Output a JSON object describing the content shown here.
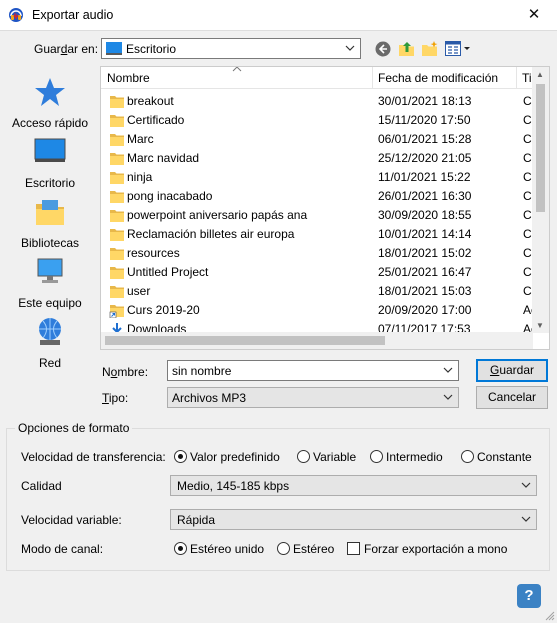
{
  "window": {
    "title": "Exportar audio",
    "close_glyph": "✕"
  },
  "save_in": {
    "label_pre": "Guar",
    "label_key": "d",
    "label_post": "ar en:",
    "value": "Escritorio"
  },
  "toolbar": {
    "icons": [
      "back-icon",
      "up-folder-icon",
      "new-folder-icon",
      "view-menu-icon"
    ]
  },
  "places": [
    {
      "label": "Acceso rápido",
      "icon": "quick-access-star-icon"
    },
    {
      "label": "Escritorio",
      "icon": "desktop-icon"
    },
    {
      "label": "Bibliotecas",
      "icon": "libraries-icon"
    },
    {
      "label": "Este equipo",
      "icon": "this-pc-icon"
    },
    {
      "label": "Red",
      "icon": "network-icon"
    }
  ],
  "columns": {
    "name": "Nombre",
    "date": "Fecha de modificación",
    "type": "Tip"
  },
  "files": [
    {
      "name": "breakout",
      "date": "30/01/2021 18:13",
      "type": "Ca",
      "icon": "folder-icon"
    },
    {
      "name": "Certificado",
      "date": "15/11/2020 17:50",
      "type": "Ca",
      "icon": "folder-icon"
    },
    {
      "name": "Marc",
      "date": "06/01/2021 15:28",
      "type": "Ca",
      "icon": "folder-icon"
    },
    {
      "name": "Marc navidad",
      "date": "25/12/2020 21:05",
      "type": "Ca",
      "icon": "folder-icon"
    },
    {
      "name": "ninja",
      "date": "11/01/2021 15:22",
      "type": "Ca",
      "icon": "folder-icon"
    },
    {
      "name": "pong inacabado",
      "date": "26/01/2021 16:30",
      "type": "Ca",
      "icon": "folder-icon"
    },
    {
      "name": "powerpoint aniversario papás ana",
      "date": "30/09/2020 18:55",
      "type": "Ca",
      "icon": "folder-icon"
    },
    {
      "name": "Reclamación billetes air europa",
      "date": "10/01/2021 14:14",
      "type": "Ca",
      "icon": "folder-icon"
    },
    {
      "name": "resources",
      "date": "18/01/2021 15:02",
      "type": "Ca",
      "icon": "folder-icon"
    },
    {
      "name": "Untitled Project",
      "date": "25/01/2021 16:47",
      "type": "Ca",
      "icon": "folder-icon"
    },
    {
      "name": "user",
      "date": "18/01/2021 15:03",
      "type": "Ca",
      "icon": "folder-icon"
    },
    {
      "name": "Curs 2019-20",
      "date": "20/09/2020 17:00",
      "type": "Ac",
      "icon": "folder-shortcut-icon"
    },
    {
      "name": "Downloads",
      "date": "07/11/2017 17:53",
      "type": "Ac",
      "icon": "downloads-shortcut-icon"
    }
  ],
  "filename": {
    "label_pre": "N",
    "label_key": "o",
    "label_post": "mbre:",
    "value": "sin nombre"
  },
  "filetype": {
    "label_pre": "",
    "label_key": "T",
    "label_post": "ipo:",
    "value": "Archivos MP3"
  },
  "buttons": {
    "save_pre": "",
    "save_key": "G",
    "save_post": "uardar",
    "cancel": "Cancelar",
    "help": "?"
  },
  "options": {
    "legend": "Opciones de formato",
    "bitrate": {
      "label": "Velocidad de transferencia:",
      "choices": [
        {
          "label": "Valor predefinido",
          "selected": true
        },
        {
          "label": "Variable",
          "selected": false
        },
        {
          "label": "Intermedio",
          "selected": false
        },
        {
          "label": "Constante",
          "selected": false
        }
      ]
    },
    "quality": {
      "label": "Calidad",
      "value": "Medio, 145-185 kbps"
    },
    "variable_speed": {
      "label": "Velocidad variable:",
      "value": "Rápida"
    },
    "channel": {
      "label": "Modo de canal:",
      "choices": [
        {
          "label": "Estéreo unido",
          "selected": true
        },
        {
          "label": "Estéreo",
          "selected": false
        }
      ],
      "force_mono": {
        "label": "Forzar exportación a mono",
        "checked": false
      }
    }
  }
}
